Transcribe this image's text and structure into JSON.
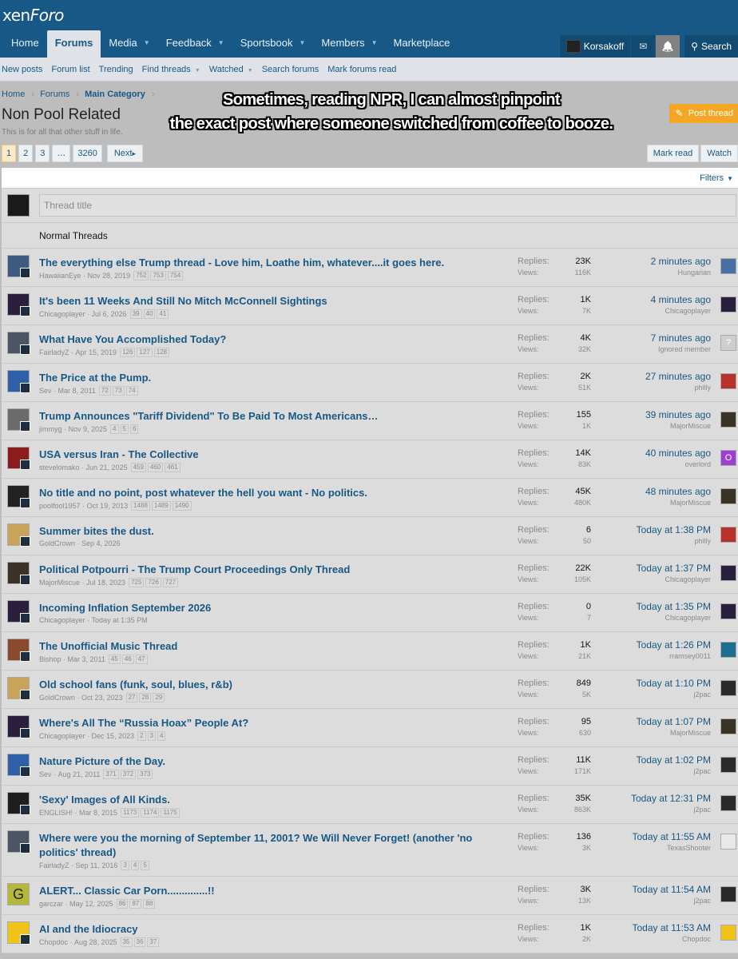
{
  "logo": {
    "part1": "xen",
    "part2": "Foro"
  },
  "nav": {
    "items": [
      {
        "label": "Home",
        "caret": false,
        "active": false
      },
      {
        "label": "Forums",
        "caret": false,
        "active": true
      },
      {
        "label": "Media",
        "caret": true,
        "active": false
      },
      {
        "label": "Feedback",
        "caret": true,
        "active": false
      },
      {
        "label": "Sportsbook",
        "caret": true,
        "active": false
      },
      {
        "label": "Members",
        "caret": true,
        "active": false
      },
      {
        "label": "Marketplace",
        "caret": false,
        "active": false
      }
    ],
    "username": "Korsakoff",
    "search_label": "Search"
  },
  "subnav": {
    "items": [
      {
        "label": "New posts",
        "caret": false
      },
      {
        "label": "Forum list",
        "caret": false
      },
      {
        "label": "Trending",
        "caret": false
      },
      {
        "label": "Find threads",
        "caret": true
      },
      {
        "label": "Watched",
        "caret": true
      },
      {
        "label": "Search forums",
        "caret": false
      },
      {
        "label": "Mark forums read",
        "caret": false
      }
    ]
  },
  "breadcrumb": {
    "home": "Home",
    "forums": "Forums",
    "category": "Main Category"
  },
  "page": {
    "title": "Non Pool Related",
    "description": "This is for all that other stuff in life.",
    "post_thread": "Post thread",
    "mark_read": "Mark read",
    "watch": "Watch"
  },
  "caption": {
    "line1": "Sometimes, reading NPR, I can almost pinpoint",
    "line2": "the exact post where someone switched from coffee to booze."
  },
  "pager": {
    "pages": [
      "1",
      "2",
      "3",
      "…",
      "3260"
    ],
    "next": "Next"
  },
  "filters_label": "Filters",
  "quick_thread_placeholder": "Thread title",
  "section_label": "Normal Threads",
  "stat_labels": {
    "replies": "Replies:",
    "views": "Views:"
  },
  "threads": [
    {
      "title": "The everything else Trump thread - Love him, Loathe him, whatever....it goes here.",
      "author": "HawaiianEye",
      "date": "Nov 28, 2019",
      "pages": [
        "752",
        "753",
        "754"
      ],
      "replies": "23K",
      "views": "116K",
      "last_time": "2 minutes ago",
      "last_user": "Hungarian",
      "av": "#3d5a80",
      "lav": "#4a6fa5"
    },
    {
      "title": "It's been 11 Weeks And Still No Mitch McConnell Sightings",
      "author": "Chicagoplayer",
      "date": "Jul 6, 2026",
      "pages": [
        "39",
        "40",
        "41"
      ],
      "replies": "1K",
      "views": "7K",
      "last_time": "4 minutes ago",
      "last_user": "Chicagoplayer",
      "av": "#2a1f3d",
      "lav": "#2a1f3d"
    },
    {
      "title": "What Have You Accomplished Today?",
      "author": "FairladyZ",
      "date": "Apr 15, 2019",
      "pages": [
        "126",
        "127",
        "128"
      ],
      "replies": "4K",
      "views": "32K",
      "last_time": "7 minutes ago",
      "last_user": "Ignored member",
      "av": "#4b5563",
      "lav": "#cfcfcf",
      "lav_letter": "?"
    },
    {
      "title": "The Price at the Pump.",
      "author": "Sev",
      "date": "Mar 8, 2011",
      "pages": [
        "72",
        "73",
        "74"
      ],
      "replies": "2K",
      "views": "51K",
      "last_time": "27 minutes ago",
      "last_user": "philly",
      "av": "#2f5fa7",
      "lav": "#b8322c"
    },
    {
      "title": "Trump Announces \"Tariff Dividend\" To Be Paid To Most Americans…",
      "author": "jimmyg",
      "date": "Nov 9, 2025",
      "pages": [
        "4",
        "5",
        "6"
      ],
      "replies": "155",
      "views": "1K",
      "last_time": "39 minutes ago",
      "last_user": "MajorMiscue",
      "av": "#6b6b6b",
      "lav": "#3a3226"
    },
    {
      "title": "USA versus Iran - The Collective",
      "author": "stevelomako",
      "date": "Jun 21, 2025",
      "pages": [
        "459",
        "460",
        "461"
      ],
      "replies": "14K",
      "views": "83K",
      "last_time": "40 minutes ago",
      "last_user": "overlord",
      "av": "#8a1c1c",
      "lav": "#9b3fd1",
      "lav_letter": "O"
    },
    {
      "title": "No title and no point, post whatever the hell you want - No politics.",
      "author": "poolfool1957",
      "date": "Oct 19, 2013",
      "pages": [
        "1488",
        "1489",
        "1490"
      ],
      "replies": "45K",
      "views": "480K",
      "last_time": "48 minutes ago",
      "last_user": "MajorMiscue",
      "av": "#222222",
      "lav": "#3a3226"
    },
    {
      "title": "Summer bites the dust.",
      "author": "GoldCrown",
      "date": "Sep 4, 2026",
      "pages": [],
      "replies": "6",
      "views": "50",
      "last_time": "Today at 1:38 PM",
      "last_user": "philly",
      "av": "#c9a35a",
      "lav": "#b8322c"
    },
    {
      "title": "Political Potpourri - The Trump Court Proceedings Only Thread",
      "author": "MajorMiscue",
      "date": "Jul 18, 2023",
      "pages": [
        "725",
        "726",
        "727"
      ],
      "replies": "22K",
      "views": "105K",
      "last_time": "Today at 1:37 PM",
      "last_user": "Chicagoplayer",
      "av": "#3a3226",
      "lav": "#2a1f3d"
    },
    {
      "title": "Incoming Inflation September 2026",
      "author": "Chicagoplayer",
      "date": "Today at 1:35 PM",
      "pages": [],
      "replies": "0",
      "views": "7",
      "last_time": "Today at 1:35 PM",
      "last_user": "Chicagoplayer",
      "av": "#2a1f3d",
      "lav": "#2a1f3d"
    },
    {
      "title": "The Unofficial Music Thread",
      "author": "Bishop",
      "date": "Mar 3, 2011",
      "pages": [
        "45",
        "46",
        "47"
      ],
      "replies": "1K",
      "views": "21K",
      "last_time": "Today at 1:26 PM",
      "last_user": "rramsey0011",
      "av": "#8b4a2b",
      "lav": "#1e6f8f"
    },
    {
      "title": "Old school fans (funk, soul, blues, r&b)",
      "author": "GoldCrown",
      "date": "Oct 23, 2023",
      "pages": [
        "27",
        "28",
        "29"
      ],
      "replies": "849",
      "views": "5K",
      "last_time": "Today at 1:10 PM",
      "last_user": "j2pac",
      "av": "#c9a35a",
      "lav": "#2b2b2b"
    },
    {
      "title": "Where's All The “Russia Hoax” People At?",
      "author": "Chicagoplayer",
      "date": "Dec 15, 2023",
      "pages": [
        "2",
        "3",
        "4"
      ],
      "replies": "95",
      "views": "630",
      "last_time": "Today at 1:07 PM",
      "last_user": "MajorMiscue",
      "av": "#2a1f3d",
      "lav": "#3a3226"
    },
    {
      "title": "Nature Picture of the Day.",
      "author": "Sev",
      "date": "Aug 21, 2011",
      "pages": [
        "371",
        "372",
        "373"
      ],
      "replies": "11K",
      "views": "171K",
      "last_time": "Today at 1:02 PM",
      "last_user": "j2pac",
      "av": "#2f5fa7",
      "lav": "#2b2b2b"
    },
    {
      "title": "'Sexy' Images of All Kinds.",
      "author": "ENGLISH!",
      "date": "Mar 8, 2015",
      "pages": [
        "1173",
        "1174",
        "1175"
      ],
      "replies": "35K",
      "views": "863K",
      "last_time": "Today at 12:31 PM",
      "last_user": "j2pac",
      "av": "#1f1f1f",
      "lav": "#2b2b2b"
    },
    {
      "title": "Where were you the morning of September 11, 2001? We Will Never Forget! (another 'no politics' thread)",
      "author": "FairladyZ",
      "date": "Sep 11, 2016",
      "pages": [
        "3",
        "4",
        "5"
      ],
      "replies": "136",
      "views": "3K",
      "last_time": "Today at 11:55 AM",
      "last_user": "TexasShooter",
      "av": "#4b5563",
      "lav": "#e8e8e8"
    },
    {
      "title": "ALERT... Classic Car Porn..............!!",
      "author": "garczar",
      "date": "May 12, 2025",
      "pages": [
        "86",
        "87",
        "88"
      ],
      "replies": "3K",
      "views": "13K",
      "last_time": "Today at 11:54 AM",
      "last_user": "j2pac",
      "av": "#b5b83a",
      "av_letter": "G",
      "lav": "#2b2b2b"
    },
    {
      "title": "AI and the Idiocracy",
      "author": "Chopdoc",
      "date": "Aug 28, 2025",
      "pages": [
        "35",
        "36",
        "37"
      ],
      "replies": "1K",
      "views": "2K",
      "last_time": "Today at 11:53 AM",
      "last_user": "Chopdoc",
      "av": "#f0c419",
      "lav": "#f0c419"
    }
  ]
}
